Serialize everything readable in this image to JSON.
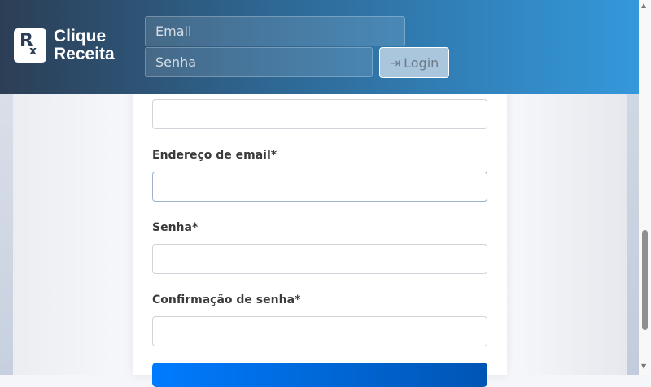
{
  "header": {
    "logo_line1": "Clique",
    "logo_line2": "Receita",
    "logo_mark": "Rx",
    "email_placeholder": "Email",
    "password_placeholder": "Senha",
    "login_label": "Login",
    "login_icon": "sign-in-icon"
  },
  "form": {
    "email_label": "Endereço de email*",
    "password_label": "Senha*",
    "confirm_label": "Confirmação de senha*"
  }
}
